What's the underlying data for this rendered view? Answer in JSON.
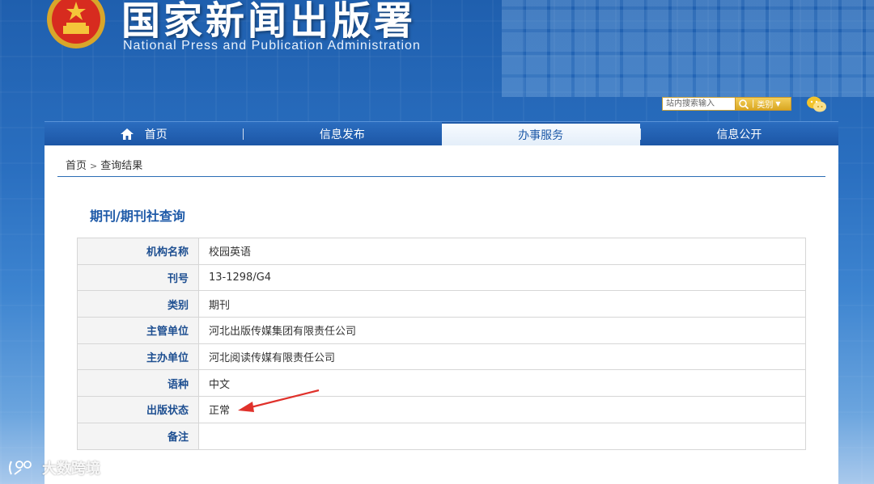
{
  "header": {
    "title": "国家新闻出版署",
    "subtitle": "National Press and Publication Administration",
    "search_placeholder": "站内搜索输入",
    "category_label": "类别"
  },
  "nav": {
    "items": [
      {
        "label": "首页"
      },
      {
        "label": "信息发布"
      },
      {
        "label": "办事服务"
      },
      {
        "label": "信息公开"
      }
    ]
  },
  "breadcrumb": {
    "home": "首页",
    "separator": ">",
    "current": "查询结果"
  },
  "section_title": "期刊/期刊社查询",
  "details": {
    "rows": [
      {
        "label": "机构名称",
        "value": "校园英语"
      },
      {
        "label": "刊号",
        "value": "13-1298/G4"
      },
      {
        "label": "类别",
        "value": "期刊"
      },
      {
        "label": "主管单位",
        "value": "河北出版传媒集团有限责任公司"
      },
      {
        "label": "主办单位",
        "value": "河北阅读传媒有限责任公司"
      },
      {
        "label": "语种",
        "value": "中文"
      },
      {
        "label": "出版状态",
        "value": "正常"
      },
      {
        "label": "备注",
        "value": ""
      }
    ]
  },
  "watermark": "大数跨境",
  "colors": {
    "accent": "#1e5aa8",
    "annotation_arrow": "#e0312b",
    "search_button": "#d9a722"
  }
}
